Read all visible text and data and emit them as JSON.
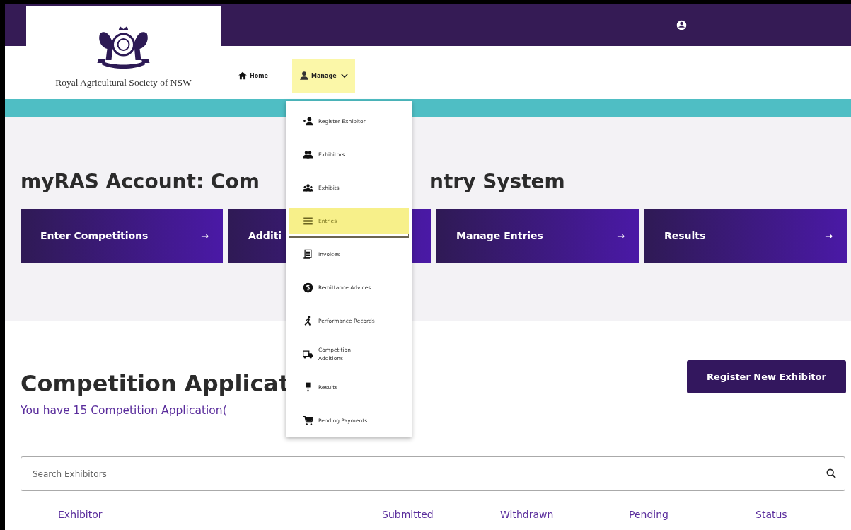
{
  "header": {
    "org_name": "Royal Agricultural Society of NSW"
  },
  "nav": [
    {
      "label": "Home",
      "selected": false
    },
    {
      "label": "Manage",
      "selected": true
    }
  ],
  "manage_menu": [
    {
      "label": "Register Exhibitor",
      "selected": false
    },
    {
      "label": "Exhibitors",
      "selected": false
    },
    {
      "label": "Exhibits",
      "selected": false
    },
    {
      "label": "Entries",
      "selected": true
    },
    {
      "label": "Invoices",
      "selected": false
    },
    {
      "label": "Remittance Advices",
      "selected": false
    },
    {
      "label": "Performance Records",
      "selected": false
    },
    {
      "label": "Competition\nAdditions",
      "selected": false
    },
    {
      "label": "Results",
      "selected": false
    },
    {
      "label": "Pending Payments",
      "selected": false
    }
  ],
  "page_title": {
    "before_menu": "myRAS Account: Com",
    "after_menu": "ntry System"
  },
  "action_cards": [
    {
      "label": "Enter Competitions",
      "arrow": "→"
    },
    {
      "label": "Additi"
    },
    {
      "label": "Manage Entries",
      "arrow": "→"
    },
    {
      "label": "Results",
      "arrow": "→"
    }
  ],
  "applications": {
    "heading": "Competition Applicat",
    "summary": "You have 15 Competition Application(",
    "register_button": "Register New Exhibitor"
  },
  "search": {
    "placeholder": "Search Exhibitors"
  },
  "table": {
    "columns": [
      "Exhibitor",
      "Submitted",
      "Withdrawn",
      "Pending",
      "Status"
    ]
  }
}
